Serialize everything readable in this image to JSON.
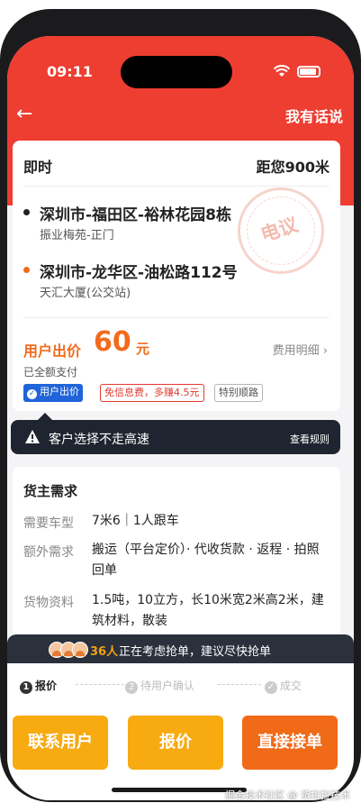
{
  "status": {
    "time": "09:11"
  },
  "nav": {
    "back_icon": "arrow-left-icon",
    "right_label": "我有话说"
  },
  "order": {
    "mode": "即时",
    "distance": "距您900米",
    "pickup": {
      "address": "深圳市-福田区-裕林花园8栋",
      "detail": "振业梅苑-正门"
    },
    "dropoff": {
      "address": "深圳市-龙华区-油松路112号",
      "detail": "天汇大厦(公交站)"
    },
    "stamp": "电议",
    "price_label": "用户出价",
    "price_value": "60",
    "price_unit": "元",
    "fee_detail": "费用明细",
    "paid_status": "已全额支付",
    "tags": [
      "用户出价",
      "免信息费，多赚4.5元",
      "特别顺路"
    ]
  },
  "notice": {
    "text": "客户选择不走高速",
    "link": "查看规则"
  },
  "requirements": {
    "title": "货主需求",
    "rows": [
      {
        "label": "需要车型",
        "value": "7米6｜1人跟车"
      },
      {
        "label": "额外需求",
        "value": "搬运（平台定价）· 代收货款 · 返程 · 拍照回单"
      },
      {
        "label": "货物资料",
        "value": "1.5吨，10立方，长10米宽2米高2米，建筑材料，散装"
      }
    ]
  },
  "consider": {
    "count": "36人",
    "text": "正在考虑抢单，建议尽快抢单"
  },
  "steps": [
    {
      "num": "1",
      "label": "报价"
    },
    {
      "num": "2",
      "label": "待用户确认"
    },
    {
      "num": "✓",
      "label": "成交"
    }
  ],
  "buttons": {
    "contact": "联系用户",
    "quote": "报价",
    "accept": "直接接单"
  },
  "watermark": "掘金技术社区 @ 货拉拉技术",
  "colors": {
    "brand_red": "#ee3d31",
    "price_orange": "#f26b1d",
    "button_yellow": "#f8aa11",
    "button_orange": "#f06a18",
    "tag_blue": "#1f64d9"
  }
}
